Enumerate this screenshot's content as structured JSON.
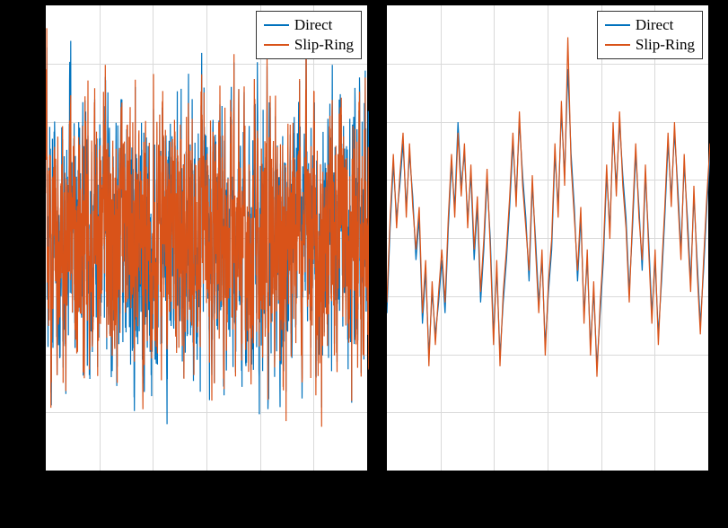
{
  "chart_data": [
    {
      "type": "line",
      "title": "",
      "xlabel": "",
      "ylabel": "",
      "xlim": [
        0,
        100
      ],
      "ylim": [
        -1.1,
        1.1
      ],
      "grid": true,
      "legend_position": "top-right",
      "series": [
        {
          "name": "Direct",
          "description": "Dense noisy oscillatory signal, amplitude roughly ±0.7 with occasional peaks to ±1.0, approx 1000 samples",
          "color": "#0072bd"
        },
        {
          "name": "Slip-Ring",
          "description": "Dense noisy oscillatory signal overlapping Direct, amplitude roughly ±0.7 with occasional peaks to ±1.0, approx 1000 samples",
          "color": "#d95319"
        }
      ],
      "note": "Left panel: full-length high-density time-series comparison; both traces visually overlap almost completely, filling the band between about -0.8 and +0.8 with spikes reaching near the top/bottom frame."
    },
    {
      "type": "line",
      "title": "",
      "xlabel": "",
      "ylabel": "",
      "xlim": [
        0,
        10
      ],
      "ylim": [
        -1.1,
        1.1
      ],
      "grid": true,
      "legend_position": "top-right",
      "series": [
        {
          "name": "Direct",
          "color": "#0072bd",
          "x": [
            0,
            0.1,
            0.2,
            0.3,
            0.4,
            0.5,
            0.6,
            0.7,
            0.8,
            0.9,
            1,
            1.1,
            1.2,
            1.3,
            1.4,
            1.5,
            1.6,
            1.7,
            1.8,
            1.9,
            2,
            2.1,
            2.2,
            2.3,
            2.4,
            2.5,
            2.6,
            2.7,
            2.8,
            2.9,
            3,
            3.1,
            3.2,
            3.3,
            3.4,
            3.5,
            3.6,
            3.7,
            3.8,
            3.9,
            4,
            4.1,
            4.2,
            4.3,
            4.4,
            4.5,
            4.6,
            4.7,
            4.8,
            4.9,
            5,
            5.1,
            5.2,
            5.3,
            5.4,
            5.5,
            5.6,
            5.7,
            5.8,
            5.9,
            6,
            6.1,
            6.2,
            6.3,
            6.4,
            6.5,
            6.6,
            6.7,
            6.8,
            6.9,
            7,
            7.1,
            7.2,
            7.3,
            7.4,
            7.5,
            7.6,
            7.7,
            7.8,
            7.9,
            8,
            8.1,
            8.2,
            8.3,
            8.4,
            8.5,
            8.6,
            8.7,
            8.8,
            8.9,
            9,
            9.1,
            9.2,
            9.3,
            9.4,
            9.5,
            9.6,
            9.7,
            9.8,
            9.9,
            10
          ],
          "y": [
            -0.35,
            0.05,
            0.35,
            0.1,
            0.25,
            0.45,
            0.15,
            0.4,
            0.2,
            -0.1,
            0.1,
            -0.4,
            -0.15,
            -0.55,
            -0.25,
            -0.45,
            -0.3,
            -0.1,
            -0.35,
            0.05,
            0.35,
            0.15,
            0.55,
            0.25,
            0.4,
            0.1,
            0.3,
            -0.1,
            0.15,
            -0.3,
            -0.05,
            0.28,
            0.0,
            -0.45,
            -0.15,
            -0.55,
            -0.3,
            -0.1,
            0.15,
            0.45,
            0.2,
            0.55,
            0.3,
            0.1,
            -0.2,
            0.25,
            0.0,
            -0.3,
            -0.1,
            -0.5,
            -0.25,
            -0.05,
            0.4,
            0.15,
            0.6,
            0.3,
            0.8,
            0.4,
            0.15,
            -0.2,
            0.1,
            -0.35,
            -0.1,
            -0.5,
            -0.25,
            -0.6,
            -0.35,
            -0.1,
            0.3,
            0.05,
            0.5,
            0.25,
            0.55,
            0.3,
            0.1,
            -0.25,
            0.05,
            0.4,
            0.15,
            -0.15,
            0.3,
            0.0,
            -0.35,
            -0.1,
            -0.45,
            -0.2,
            0.1,
            0.45,
            0.2,
            0.5,
            0.25,
            -0.05,
            0.35,
            0.1,
            -0.2,
            0.2,
            -0.1,
            -0.4,
            -0.15,
            0.15,
            0.4
          ]
        },
        {
          "name": "Slip-Ring",
          "color": "#d95319",
          "x": [
            0,
            0.1,
            0.2,
            0.3,
            0.4,
            0.5,
            0.6,
            0.7,
            0.8,
            0.9,
            1,
            1.1,
            1.2,
            1.3,
            1.4,
            1.5,
            1.6,
            1.7,
            1.8,
            1.9,
            2,
            2.1,
            2.2,
            2.3,
            2.4,
            2.5,
            2.6,
            2.7,
            2.8,
            2.9,
            3,
            3.1,
            3.2,
            3.3,
            3.4,
            3.5,
            3.6,
            3.7,
            3.8,
            3.9,
            4,
            4.1,
            4.2,
            4.3,
            4.4,
            4.5,
            4.6,
            4.7,
            4.8,
            4.9,
            5,
            5.1,
            5.2,
            5.3,
            5.4,
            5.5,
            5.6,
            5.7,
            5.8,
            5.9,
            6,
            6.1,
            6.2,
            6.3,
            6.4,
            6.5,
            6.6,
            6.7,
            6.8,
            6.9,
            7,
            7.1,
            7.2,
            7.3,
            7.4,
            7.5,
            7.6,
            7.7,
            7.8,
            7.9,
            8,
            8.1,
            8.2,
            8.3,
            8.4,
            8.5,
            8.6,
            8.7,
            8.8,
            8.9,
            9,
            9.1,
            9.2,
            9.3,
            9.4,
            9.5,
            9.6,
            9.7,
            9.8,
            9.9,
            10
          ],
          "y": [
            -0.3,
            0.1,
            0.4,
            0.05,
            0.3,
            0.5,
            0.1,
            0.45,
            0.15,
            -0.05,
            0.15,
            -0.35,
            -0.1,
            -0.6,
            -0.2,
            -0.5,
            -0.25,
            -0.05,
            -0.3,
            0.1,
            0.4,
            0.1,
            0.5,
            0.2,
            0.45,
            0.05,
            0.35,
            -0.05,
            0.2,
            -0.25,
            0.0,
            0.33,
            -0.05,
            -0.5,
            -0.1,
            -0.6,
            -0.25,
            -0.05,
            0.2,
            0.5,
            0.15,
            0.6,
            0.25,
            0.05,
            -0.15,
            0.3,
            -0.05,
            -0.35,
            -0.05,
            -0.55,
            -0.2,
            0.0,
            0.45,
            0.1,
            0.65,
            0.25,
            0.95,
            0.35,
            0.1,
            -0.15,
            0.15,
            -0.4,
            -0.05,
            -0.55,
            -0.2,
            -0.65,
            -0.3,
            -0.05,
            0.35,
            0.0,
            0.55,
            0.2,
            0.6,
            0.25,
            0.05,
            -0.3,
            0.1,
            0.45,
            0.1,
            -0.1,
            0.35,
            -0.05,
            -0.4,
            -0.05,
            -0.5,
            -0.15,
            0.15,
            0.5,
            0.15,
            0.55,
            0.2,
            -0.1,
            0.4,
            0.05,
            -0.25,
            0.25,
            -0.15,
            -0.45,
            -0.1,
            0.2,
            0.45
          ]
        }
      ],
      "note": "Right panel: zoomed segment; both series co-oscillate, Slip-Ring (orange) slightly leads/overshoots Direct (blue); largest positive peak near x≈5.6 reaching ~0.95."
    }
  ],
  "legend": {
    "items": [
      {
        "label": "Direct",
        "color": "#0072bd"
      },
      {
        "label": "Slip-Ring",
        "color": "#d95319"
      }
    ]
  }
}
